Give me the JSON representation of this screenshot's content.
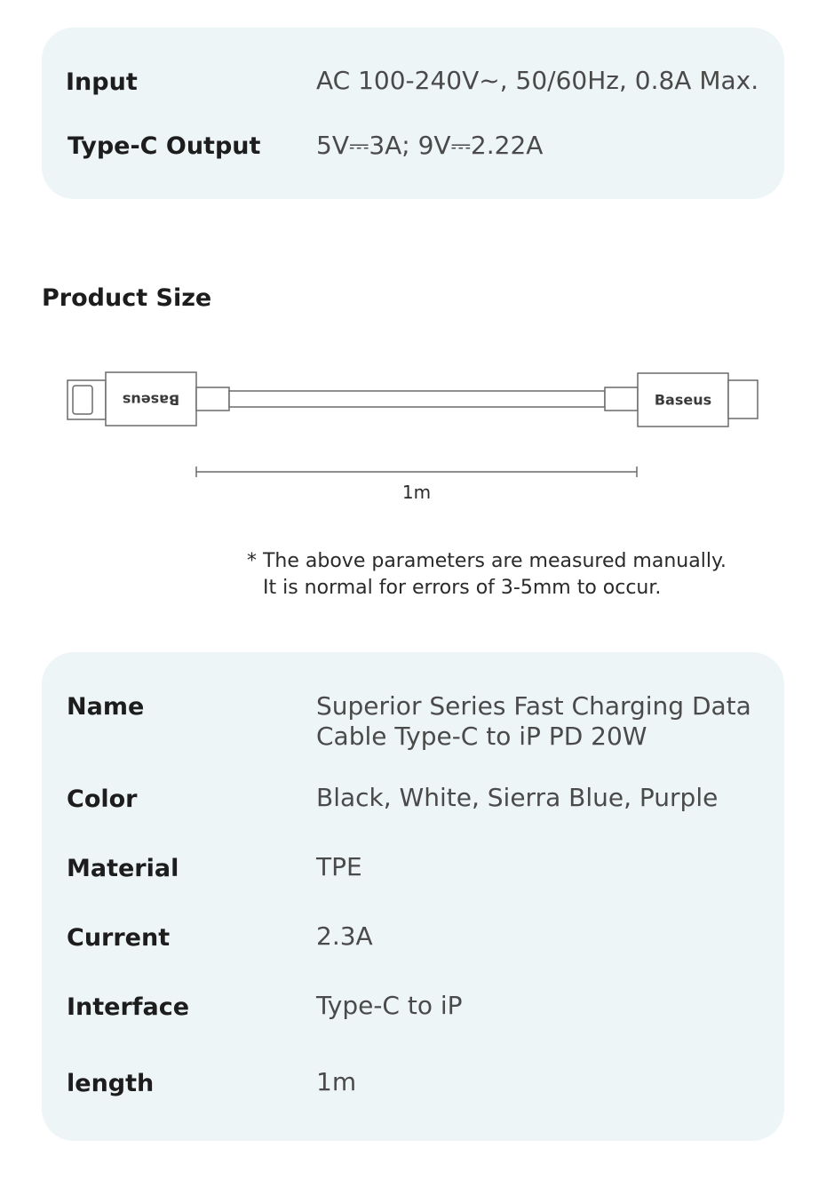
{
  "power": {
    "rows": [
      {
        "label": "Input",
        "value": "AC 100-240V~,   50/60Hz, 0.8A Max."
      },
      {
        "label": "Type-C Output",
        "value": "5V⎓3A; 9V⎓2.22A"
      }
    ]
  },
  "product_size": {
    "title": "Product Size",
    "brand_left": "Baseus",
    "brand_right": "Baseus",
    "dimension_label": "1m",
    "note_line1": "* The above parameters are measured manually.",
    "note_line2": "It is normal for errors of 3-5mm to occur."
  },
  "specs": {
    "rows": [
      {
        "label": "Name",
        "value_line1": "Superior Series Fast Charging Data",
        "value_line2": "Cable Type-C to iP PD 20W"
      },
      {
        "label": "Color",
        "value": "Black, White, Sierra Blue, Purple"
      },
      {
        "label": "Material",
        "value": "TPE"
      },
      {
        "label": "Current",
        "value": "2.3A"
      },
      {
        "label": "Interface",
        "value": "Type-C to iP"
      },
      {
        "label": "length",
        "value": "1m"
      }
    ]
  },
  "colors": {
    "card_background": "#eef5f7",
    "diagram_stroke": "#6a6a6a"
  }
}
